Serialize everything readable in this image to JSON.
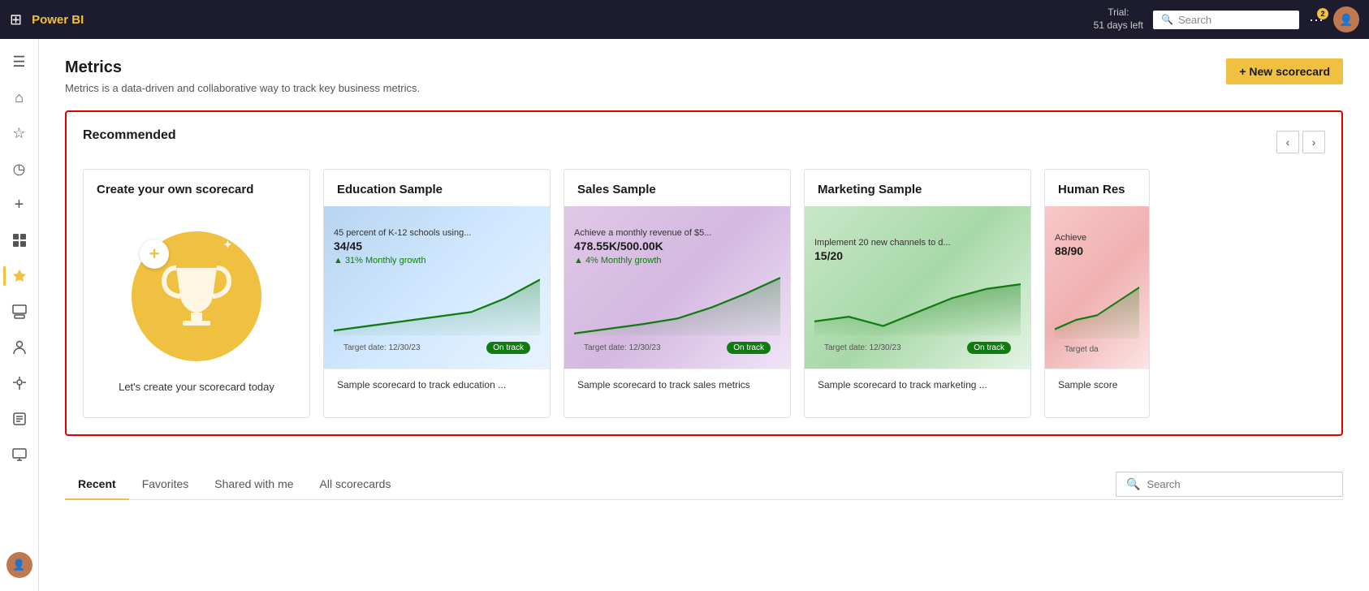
{
  "topnav": {
    "logo": "Power BI",
    "trial_line1": "Trial:",
    "trial_line2": "51 days left",
    "search_placeholder": "Search",
    "notification_count": "2"
  },
  "sidebar": {
    "items": [
      {
        "icon": "☰",
        "name": "menu-icon",
        "active": false
      },
      {
        "icon": "⌂",
        "name": "home-icon",
        "active": false
      },
      {
        "icon": "★",
        "name": "favorites-icon",
        "active": false
      },
      {
        "icon": "◷",
        "name": "recents-icon",
        "active": false
      },
      {
        "icon": "+",
        "name": "create-icon",
        "active": false
      },
      {
        "icon": "⬡",
        "name": "apps-icon",
        "active": false
      },
      {
        "icon": "🏆",
        "name": "metrics-icon",
        "active": true
      },
      {
        "icon": "⊞",
        "name": "workspace-icon",
        "active": false
      },
      {
        "icon": "👤",
        "name": "people-icon",
        "active": false
      },
      {
        "icon": "🚀",
        "name": "deploy-icon",
        "active": false
      },
      {
        "icon": "📖",
        "name": "learn-icon",
        "active": false
      },
      {
        "icon": "🖥",
        "name": "screen-icon",
        "active": false
      }
    ]
  },
  "page": {
    "title": "Metrics",
    "subtitle": "Metrics is a data-driven and collaborative way to track key business metrics.",
    "new_scorecard_btn": "+ New scorecard"
  },
  "recommended": {
    "title": "Recommended",
    "create_card": {
      "title": "Create your own scorecard",
      "description": "Let's create your scorecard today"
    },
    "cards": [
      {
        "id": "education",
        "title": "Education Sample",
        "metric_title": "45 percent of K-12 schools using...",
        "metric_value": "34/45",
        "growth": "▲ 31% Monthly growth",
        "target_date": "Target date: 12/30/23",
        "status": "On track",
        "description": "Sample scorecard to track education ...",
        "bg_class": "education-bg",
        "chart_color": "#107c10"
      },
      {
        "id": "sales",
        "title": "Sales Sample",
        "metric_title": "Achieve a monthly revenue of $5...",
        "metric_value": "478.55K/500.00K",
        "growth": "▲ 4% Monthly growth",
        "target_date": "Target date: 12/30/23",
        "status": "On track",
        "description": "Sample scorecard to track sales metrics",
        "bg_class": "sales-bg",
        "chart_color": "#107c10"
      },
      {
        "id": "marketing",
        "title": "Marketing Sample",
        "metric_title": "Implement 20 new channels to d...",
        "metric_value": "15/20",
        "growth": "",
        "target_date": "Target date: 12/30/23",
        "status": "On track",
        "description": "Sample scorecard to track marketing ...",
        "bg_class": "marketing-bg",
        "chart_color": "#107c10"
      },
      {
        "id": "human",
        "title": "Human Res",
        "metric_title": "Achieve",
        "metric_value": "88/90",
        "growth": "",
        "target_date": "Target da",
        "status": "",
        "description": "Sample score",
        "bg_class": "human-bg",
        "chart_color": "#107c10"
      }
    ]
  },
  "bottom_tabs": {
    "tabs": [
      {
        "label": "Recent",
        "active": true
      },
      {
        "label": "Favorites",
        "active": false
      },
      {
        "label": "Shared with me",
        "active": false
      },
      {
        "label": "All scorecards",
        "active": false
      }
    ],
    "search_placeholder": "Search"
  }
}
